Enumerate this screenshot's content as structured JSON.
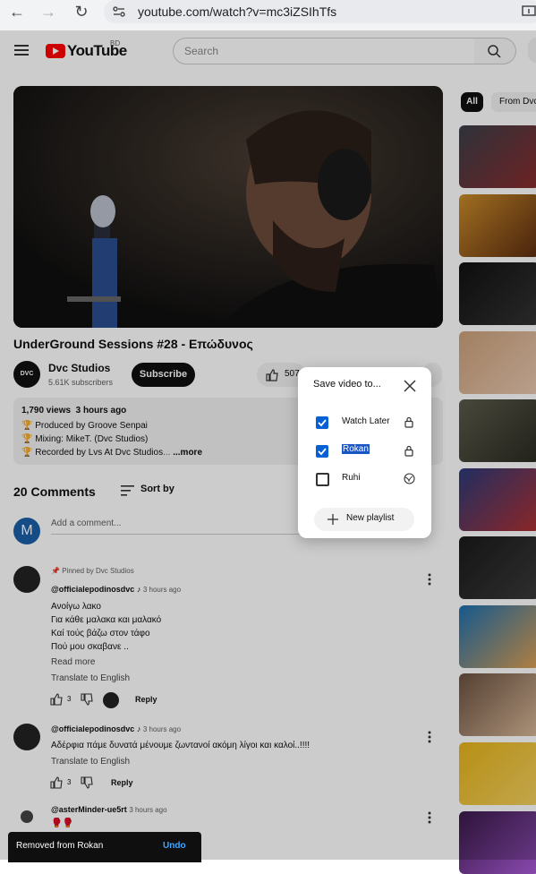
{
  "browser": {
    "url": "youtube.com/watch?v=mc3iZSIhTfs"
  },
  "header": {
    "logo_text": "YouTube",
    "region": "BD",
    "search_placeholder": "Search"
  },
  "chips": [
    "All",
    "From Dvc"
  ],
  "video": {
    "title": "UnderGround Sessions #28 - Επώδυνος"
  },
  "channel": {
    "name": "Dvc Studios",
    "subscribers": "5.61K subscribers",
    "subscribe_label": "Subscribe",
    "avatar_text": "DVC"
  },
  "likes": {
    "count": "507"
  },
  "description": {
    "views": "1,790 views",
    "time": "3 hours ago",
    "lines": [
      "Produced by Groove Senpai",
      "Mixing: MikeT. (Dvc Studios)",
      "Recorded by Lvs At Dvc Studios"
    ],
    "ellipsis": "...",
    "more": "...more"
  },
  "comments": {
    "count_label": "20 Comments",
    "sort_label": "Sort by",
    "add_placeholder": "Add a comment...",
    "me_initial": "M",
    "items": [
      {
        "pinned": "Pinned by Dvc Studios",
        "author": "@officialepodinosdvc",
        "time": "3 hours ago",
        "lines": [
          "Ανοίγω λακο",
          "Για κάθε μαλακα και μαλακό",
          "Καί τούς βάζω στον τάφο",
          "Πού μου σκαβανε .."
        ],
        "read_more": "Read more",
        "translate": "Translate to English",
        "likes": "3",
        "reply": "Reply"
      },
      {
        "author": "@officialepodinosdvc",
        "time": "3 hours ago",
        "lines": [
          "Αδέρφια πάμε δυνατά μένουμε ζωντανοί ακόμη λίγοι και καλοί..!!!!"
        ],
        "translate": "Translate to English",
        "likes": "3",
        "reply": "Reply"
      },
      {
        "author": "@asterMinder-ue5rt",
        "time": "3 hours ago",
        "lines": [
          "🥊🥊"
        ]
      }
    ]
  },
  "dialog": {
    "title": "Save video to...",
    "playlists": [
      {
        "name": "Watch Later",
        "checked": true,
        "privacy": "lock-icon"
      },
      {
        "name": "Rokan",
        "checked": true,
        "privacy": "lock-icon"
      },
      {
        "name": "Ruhi",
        "checked": false,
        "privacy": "globe-icon"
      }
    ],
    "new_playlist": "New playlist"
  },
  "toast": {
    "message": "Removed from Rokan",
    "action": "Undo"
  },
  "colors": {
    "brand_red": "#ff0000",
    "accent_blue": "#065fd4",
    "toast_bg": "#0f0f0f"
  }
}
